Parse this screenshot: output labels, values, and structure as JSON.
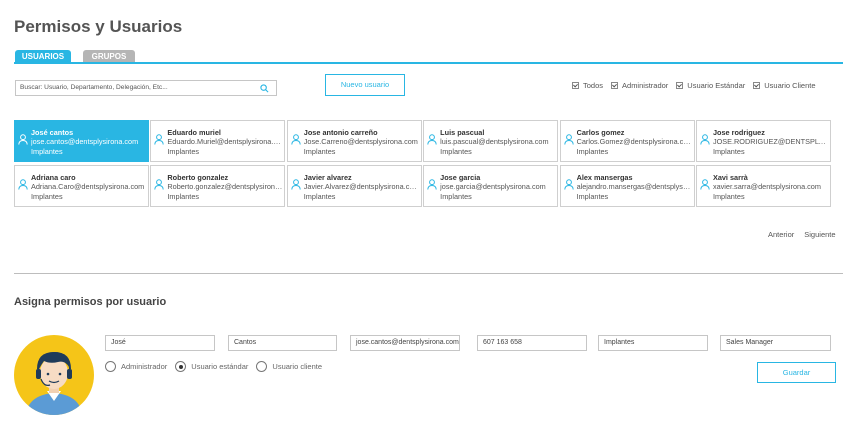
{
  "page": {
    "title": "Permisos y Usuarios"
  },
  "tabs": [
    {
      "label": "USUARIOS",
      "active": true
    },
    {
      "label": "GRUPOS",
      "active": false
    }
  ],
  "search": {
    "placeholder": "Buscar: Usuario, Departamento, Delegación, Etc...",
    "icon": "search-icon"
  },
  "toolbar": {
    "new_user_label": "Nuevo usuario"
  },
  "filters": [
    {
      "label": "Todos",
      "checked": true
    },
    {
      "label": "Administrador",
      "checked": true
    },
    {
      "label": "Usuario Estándar",
      "checked": true
    },
    {
      "label": "Usuario Cliente",
      "checked": true
    }
  ],
  "users": [
    {
      "name": "José cantos",
      "email": "jose.cantos@dentsplysirona.com",
      "dept": "Implantes",
      "selected": true
    },
    {
      "name": "Eduardo muriel",
      "email": "Eduardo.Muriel@dentsplysirona.com",
      "dept": "Implantes"
    },
    {
      "name": "Jose antonio carreño",
      "email": "Jose.Carreno@dentsplysirona.com",
      "dept": "Implantes"
    },
    {
      "name": "Luis pascual",
      "email": "luis.pascual@dentsplysirona.com",
      "dept": "Implantes"
    },
    {
      "name": "Carlos gomez",
      "email": "Carlos.Gomez@dentsplysirona.com",
      "dept": "Implantes"
    },
    {
      "name": "Jose rodriguez",
      "email": "JOSE.RODRIGUEZ@DENTSPLYSIRONA.COM",
      "dept": "Implantes"
    },
    {
      "name": "Adriana caro",
      "email": "Adriana.Caro@dentsplysirona.com",
      "dept": "Implantes"
    },
    {
      "name": "Roberto gonzalez",
      "email": "Roberto.gonzalez@dentsplysirona.com",
      "dept": "Implantes"
    },
    {
      "name": "Javier alvarez",
      "email": "Javier.Alvarez@dentsplysirona.com",
      "dept": "Implantes"
    },
    {
      "name": "Jose garcia",
      "email": "jose.garcia@dentsplysirona.com",
      "dept": "Implantes"
    },
    {
      "name": "Alex mansergas",
      "email": "alejandro.mansergas@dentsplysirona.com",
      "dept": "Implantes"
    },
    {
      "name": "Xavi sarrà",
      "email": "xavier.sarra@dentsplysirona.com",
      "dept": "Implantes"
    }
  ],
  "pager": {
    "prev": "Anterior",
    "next": "Siguiente"
  },
  "permissions": {
    "title": "Asigna permisos por usuario",
    "fields": {
      "first_name": "José",
      "last_name": "Cantos",
      "email": "jose.cantos@dentsplysirona.com",
      "phone": "607 163 658",
      "department": "Implantes",
      "role": "Sales Manager"
    },
    "roles": [
      {
        "label": "Administrador",
        "selected": false
      },
      {
        "label": "Usuario estándar",
        "selected": true
      },
      {
        "label": "Usuario cliente",
        "selected": false
      }
    ],
    "save_label": "Guardar"
  },
  "colors": {
    "accent": "#29b6e3",
    "tab_inactive": "#b5b5b5",
    "avatar_bg": "#f5c518"
  }
}
